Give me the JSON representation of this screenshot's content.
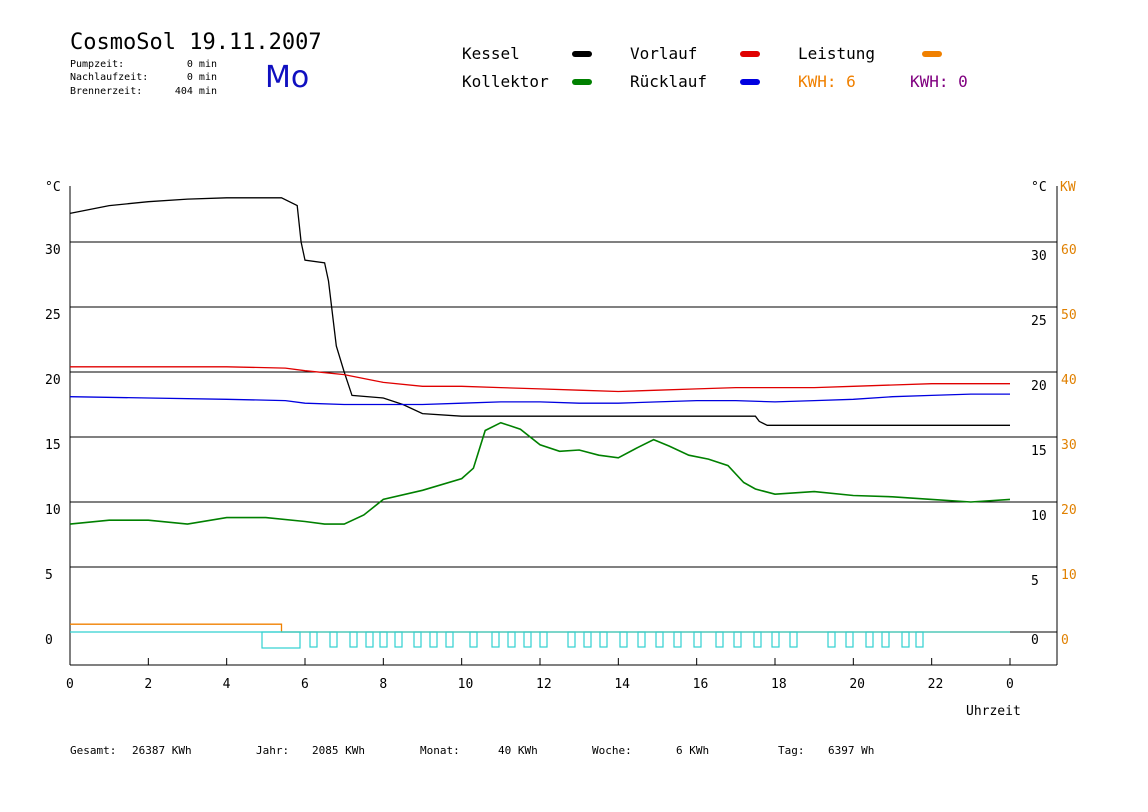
{
  "header": {
    "title": "CosmoSol 19.11.2007",
    "day": "Mo",
    "stats": [
      {
        "label": "Pumpzeit:",
        "value": "0 min"
      },
      {
        "label": "Nachlaufzeit:",
        "value": "0 min"
      },
      {
        "label": "Brennerzeit:",
        "value": "404 min"
      }
    ]
  },
  "legend": {
    "kessel": {
      "label": "Kessel",
      "color": "#000000"
    },
    "kollektor": {
      "label": "Kollektor",
      "color": "#008000"
    },
    "vorlauf": {
      "label": "Vorlauf",
      "color": "#e00000"
    },
    "ruecklauf": {
      "label": "Rücklauf",
      "color": "#0000e0"
    },
    "leistung": {
      "label": "Leistung",
      "color": "#f08000"
    },
    "kwh1": "KWH: 6",
    "kwh2": "KWH: 0",
    "kwh1_color": "#f08000",
    "kwh2_color": "#800080"
  },
  "footer": [
    {
      "label": "Gesamt:",
      "value": "26387 KWh"
    },
    {
      "label": "Jahr:",
      "value": "2085 KWh"
    },
    {
      "label": "Monat:",
      "value": "40 KWh"
    },
    {
      "label": "Woche:",
      "value": "6 KWh"
    },
    {
      "label": "Tag:",
      "value": "6397 Wh"
    }
  ],
  "chart_data": {
    "type": "line",
    "xlabel": "Uhrzeit",
    "ylabel_left": "°C",
    "ylabel_right": "°C",
    "ylabel_right2": "KW",
    "xlim": [
      0,
      24
    ],
    "ylim": [
      0,
      35
    ],
    "y2lim": [
      0,
      70
    ],
    "xticks": [
      "0",
      "2",
      "4",
      "6",
      "8",
      "10",
      "12",
      "14",
      "16",
      "18",
      "20",
      "22",
      "0"
    ],
    "yticks": [
      "0",
      "5",
      "10",
      "15",
      "20",
      "25",
      "30"
    ],
    "y2ticks": [
      "0",
      "10",
      "20",
      "30",
      "40",
      "50",
      "60"
    ],
    "grid": true,
    "series": [
      {
        "name": "Kessel",
        "color": "#000000",
        "x": [
          0,
          0.5,
          1,
          2,
          3,
          4,
          5,
          5.4,
          5.8,
          5.9,
          6.0,
          6.5,
          6.6,
          6.8,
          7.0,
          7.2,
          8.0,
          8.5,
          9.0,
          10,
          12,
          14,
          16,
          17.5,
          17.6,
          17.8,
          24
        ],
        "y": [
          32.2,
          32.5,
          32.8,
          33.1,
          33.3,
          33.4,
          33.4,
          33.4,
          32.8,
          30,
          28.6,
          28.4,
          27,
          22,
          20,
          18.2,
          18,
          17.5,
          16.8,
          16.6,
          16.6,
          16.6,
          16.6,
          16.6,
          16.2,
          15.9,
          15.9
        ]
      },
      {
        "name": "Vorlauf",
        "color": "#e00000",
        "x": [
          0,
          2,
          4,
          5.5,
          6,
          7,
          8,
          9,
          10,
          11,
          12,
          13,
          14,
          15,
          16,
          17,
          18,
          19,
          20,
          21,
          22,
          23,
          24
        ],
        "y": [
          20.4,
          20.4,
          20.4,
          20.3,
          20.1,
          19.8,
          19.2,
          18.9,
          18.9,
          18.8,
          18.7,
          18.6,
          18.5,
          18.6,
          18.7,
          18.8,
          18.8,
          18.8,
          18.9,
          19.0,
          19.1,
          19.1,
          19.1
        ]
      },
      {
        "name": "Rücklauf",
        "color": "#0000e0",
        "x": [
          0,
          2,
          4,
          5.5,
          6,
          7,
          8,
          9,
          10,
          11,
          12,
          13,
          14,
          15,
          16,
          17,
          18,
          19,
          20,
          21,
          22,
          23,
          24
        ],
        "y": [
          18.1,
          18.0,
          17.9,
          17.8,
          17.6,
          17.5,
          17.5,
          17.5,
          17.6,
          17.7,
          17.7,
          17.6,
          17.6,
          17.7,
          17.8,
          17.8,
          17.7,
          17.8,
          17.9,
          18.1,
          18.2,
          18.3,
          18.3
        ]
      },
      {
        "name": "Kollektor",
        "color": "#008000",
        "x": [
          0,
          1,
          2,
          3,
          4,
          5,
          6,
          6.5,
          7,
          7.5,
          8,
          9,
          10,
          10.3,
          10.6,
          11,
          11.5,
          12,
          12.5,
          13,
          13.5,
          14,
          14.5,
          14.9,
          15.3,
          15.8,
          16.3,
          16.8,
          17.2,
          17.5,
          18,
          19,
          20,
          21,
          22,
          23,
          24
        ],
        "y": [
          8.3,
          8.6,
          8.6,
          8.3,
          8.8,
          8.8,
          8.5,
          8.3,
          8.3,
          9.0,
          10.2,
          10.9,
          11.8,
          12.6,
          15.5,
          16.1,
          15.6,
          14.4,
          13.9,
          14.0,
          13.6,
          13.4,
          14.2,
          14.8,
          14.3,
          13.6,
          13.3,
          12.8,
          11.5,
          11.0,
          10.6,
          10.8,
          10.5,
          10.4,
          10.2,
          10.0,
          10.2
        ]
      },
      {
        "name": "Leistung",
        "color": "#f08000",
        "x": [
          0,
          5.4,
          5.4,
          24
        ],
        "y": [
          0.6,
          0.6,
          0,
          0
        ]
      }
    ]
  }
}
